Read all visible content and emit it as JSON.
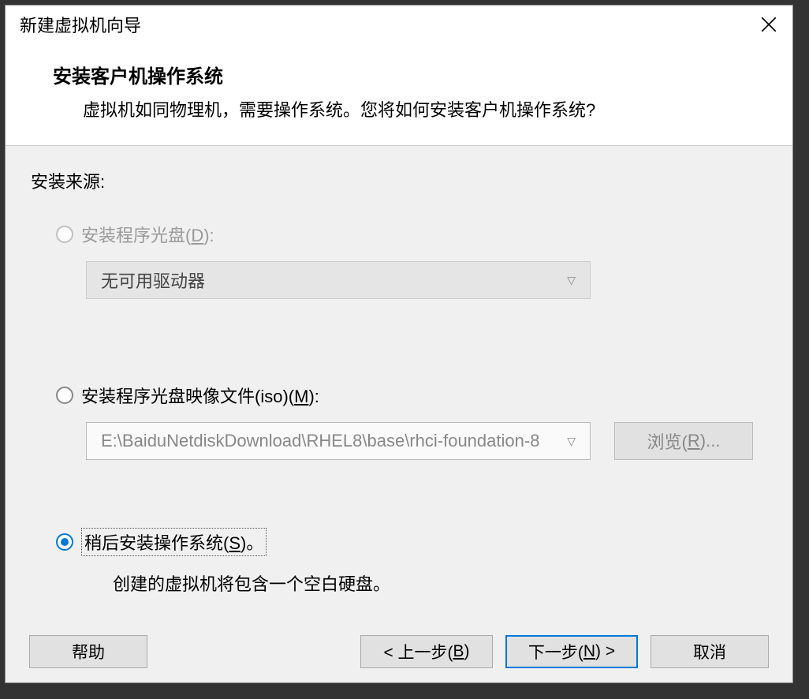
{
  "titlebar": {
    "title": "新建虚拟机向导"
  },
  "header": {
    "title": "安装客户机操作系统",
    "description": "虚拟机如同物理机，需要操作系统。您将如何安装客户机操作系统?"
  },
  "content": {
    "section_label": "安装来源:",
    "option_disc": {
      "label_prefix": "安装程序光盘(",
      "access_key": "D",
      "label_suffix": "):",
      "dropdown_value": "无可用驱动器"
    },
    "option_iso": {
      "label_prefix": "安装程序光盘映像文件(iso)(",
      "access_key": "M",
      "label_suffix": "):",
      "path_value": "E:\\BaiduNetdiskDownload\\RHEL8\\base\\rhci-foundation-8",
      "browse_prefix": "浏览(",
      "browse_key": "R",
      "browse_suffix": ")..."
    },
    "option_later": {
      "label_prefix": "稍后安装操作系统(",
      "access_key": "S",
      "label_suffix": ")。",
      "hint": "创建的虚拟机将包含一个空白硬盘。"
    }
  },
  "footer": {
    "help": "帮助",
    "back_prefix": "< 上一步(",
    "back_key": "B",
    "back_suffix": ")",
    "next_prefix": "下一步(",
    "next_key": "N",
    "next_suffix": ") >",
    "cancel": "取消"
  }
}
